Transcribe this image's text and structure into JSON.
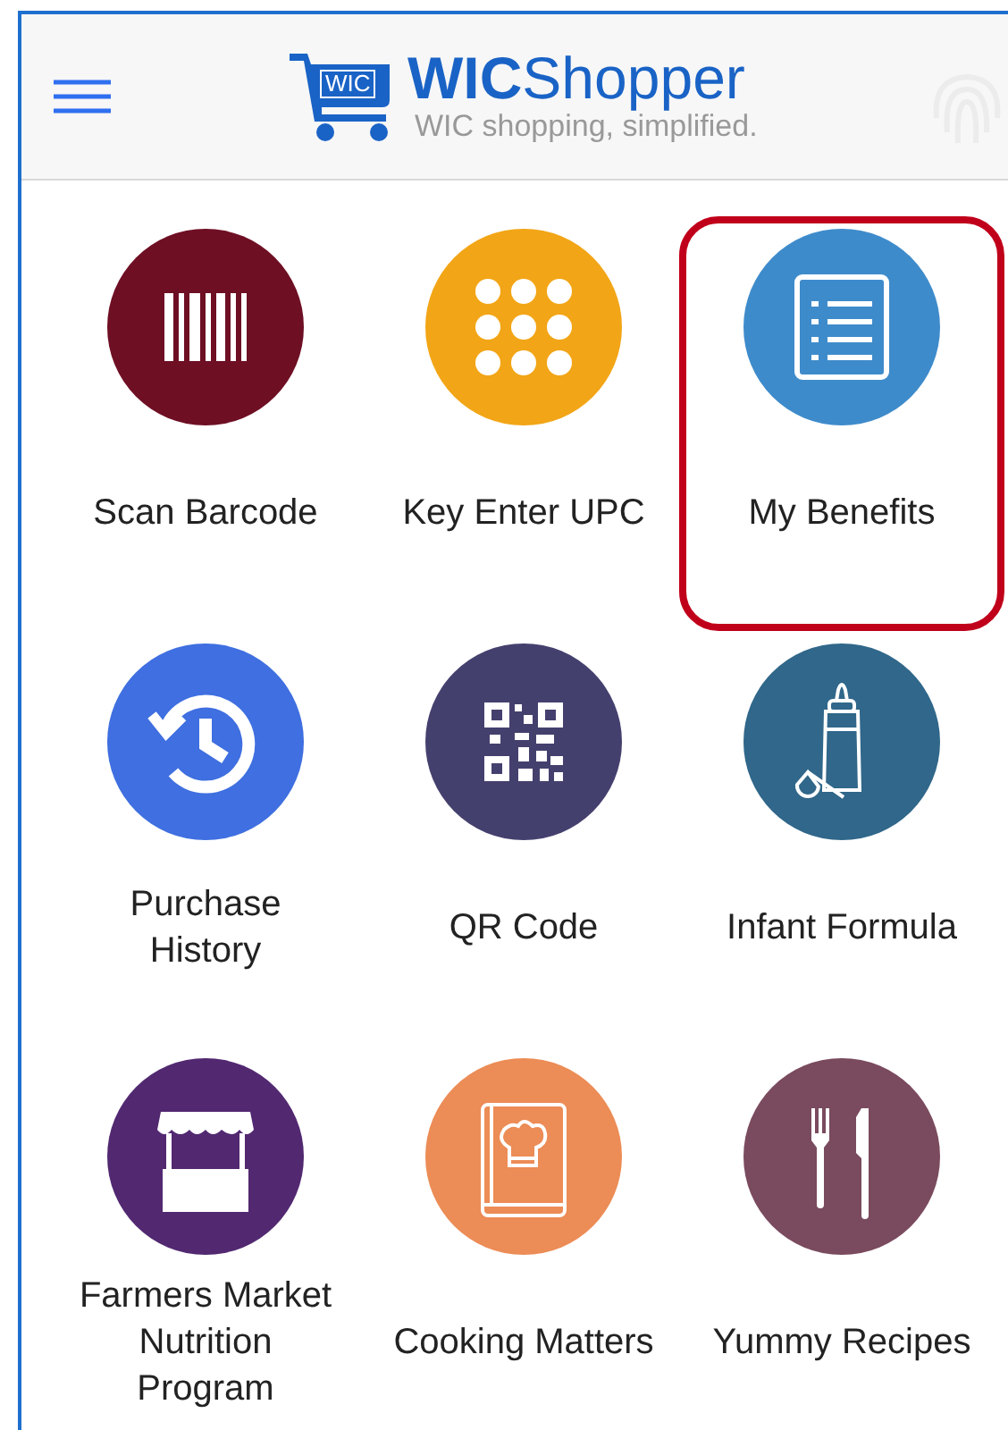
{
  "header": {
    "cart_label": "WIC",
    "brand": "**WIC**Shopper",
    "tagline": "WIC shopping, simplified."
  },
  "tiles": [
    {
      "label": "Scan Barcode",
      "kind": "barcode",
      "color": "#6e0f24",
      "selected": false
    },
    {
      "label": "Key Enter UPC",
      "kind": "keypad",
      "color": "#f2a516",
      "selected": false
    },
    {
      "label": "My Benefits",
      "kind": "list",
      "color": "#3e8bcb",
      "selected": true
    },
    {
      "label": "Purchase History",
      "kind": "history",
      "color": "#3f6fe0",
      "selected": false
    },
    {
      "label": "QR Code",
      "kind": "qr",
      "color": "#44406e",
      "selected": false
    },
    {
      "label": "Infant Formula",
      "kind": "bottle",
      "color": "#30678a",
      "selected": false
    },
    {
      "label": "Farmers Market Nutrition Program",
      "kind": "stand",
      "color": "#522871",
      "selected": false
    },
    {
      "label": "Cooking Matters",
      "kind": "book",
      "color": "#ec8c56",
      "selected": false
    },
    {
      "label": "Yummy Recipes",
      "kind": "cutlery",
      "color": "#7a4a5e",
      "selected": false
    }
  ]
}
